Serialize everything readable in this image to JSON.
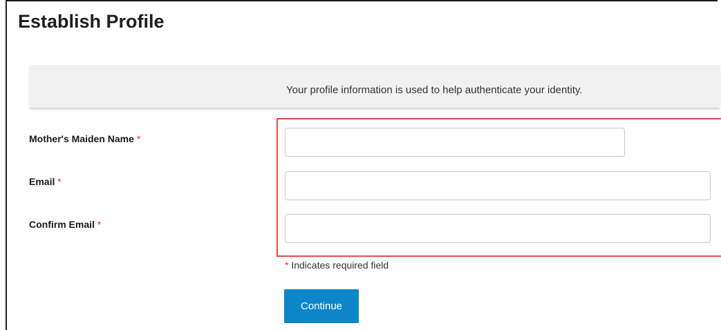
{
  "page": {
    "title": "Establish Profile"
  },
  "banner": {
    "text": "Your profile information is used to help authenticate your identity."
  },
  "form": {
    "required_marker": "*",
    "fields": [
      {
        "label": "Mother's Maiden Name",
        "value": "",
        "placeholder": "",
        "required": true
      },
      {
        "label": "Email",
        "value": "",
        "placeholder": "",
        "required": true
      },
      {
        "label": "Confirm Email",
        "value": "",
        "placeholder": "",
        "required": true
      }
    ],
    "required_note": "Indicates required field",
    "continue_label": "Continue"
  },
  "colors": {
    "accent": "#0d86c9",
    "required": "#e5302f",
    "highlight": "#e04a4a",
    "banner_bg": "#f1f1f1"
  }
}
